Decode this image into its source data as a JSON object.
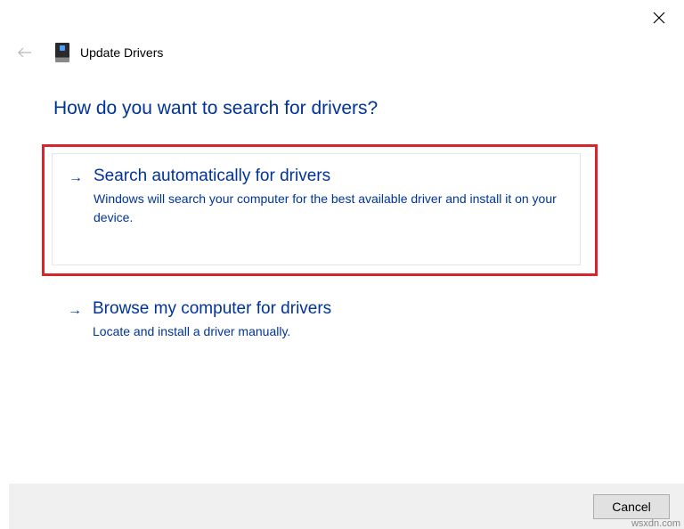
{
  "header": {
    "title": "Update Drivers"
  },
  "question": "How do you want to search for drivers?",
  "options": {
    "auto": {
      "title": "Search automatically for drivers",
      "desc": "Windows will search your computer for the best available driver and install it on your device."
    },
    "browse": {
      "title": "Browse my computer for drivers",
      "desc": "Locate and install a driver manually."
    }
  },
  "footer": {
    "cancel": "Cancel"
  },
  "watermark": "wsxdn.com"
}
